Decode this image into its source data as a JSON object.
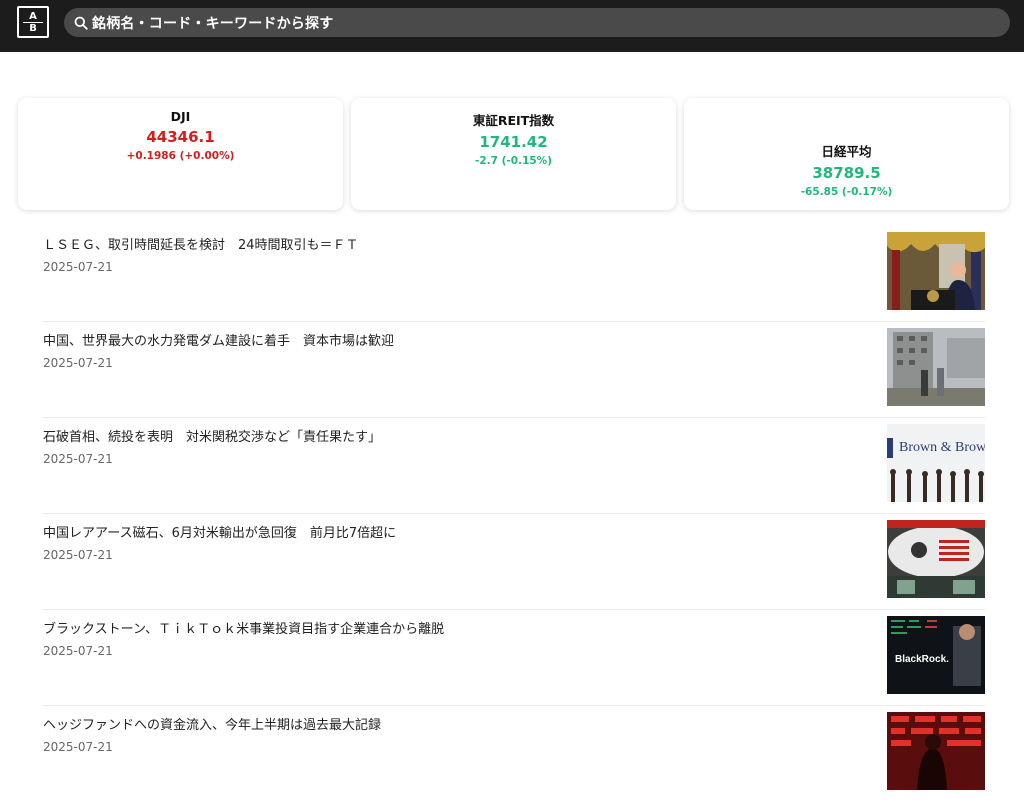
{
  "header": {
    "logo_top": "A",
    "logo_bottom": "B",
    "search_placeholder": "銘柄名・コード・キーワードから探す"
  },
  "colors": {
    "up": "#d81b1b",
    "down": "#1fb87a",
    "topbar": "#1c1c1c"
  },
  "indices": [
    {
      "name": "DJI",
      "value": "44346.1",
      "change": "+0.1986 (+0.00%)",
      "direction": "up"
    },
    {
      "name": "東証REIT指数",
      "value": "1741.42",
      "change": "-2.7 (-0.15%)",
      "direction": "down"
    },
    {
      "name": "日経平均",
      "value": "38789.5",
      "change": "-65.85 (-0.17%)",
      "direction": "down"
    }
  ],
  "news": [
    {
      "title": "ＬＳＥＧ、取引時間延長を検討　24時間取引も＝ＦＴ",
      "date": "2025-07-21",
      "thumb_caption": ""
    },
    {
      "title": "中国、世界最大の水力発電ダム建設に着手　資本市場は歓迎",
      "date": "2025-07-21",
      "thumb_caption": ""
    },
    {
      "title": "石破首相、続投を表明　対米関税交渉など「責任果たす」",
      "date": "2025-07-21",
      "thumb_caption": "Brown & Brown"
    },
    {
      "title": "中国レアアース磁石、6月対米輸出が急回復　前月比7倍超に",
      "date": "2025-07-21",
      "thumb_caption": ""
    },
    {
      "title": "ブラックストーン、ＴｉｋＴｏｋ米事業投資目指す企業連合から離脱",
      "date": "2025-07-21",
      "thumb_caption": "BlackRock."
    },
    {
      "title": "ヘッジファンドへの資金流入、今年上半期は過去最大記録",
      "date": "2025-07-21",
      "thumb_caption": ""
    }
  ]
}
